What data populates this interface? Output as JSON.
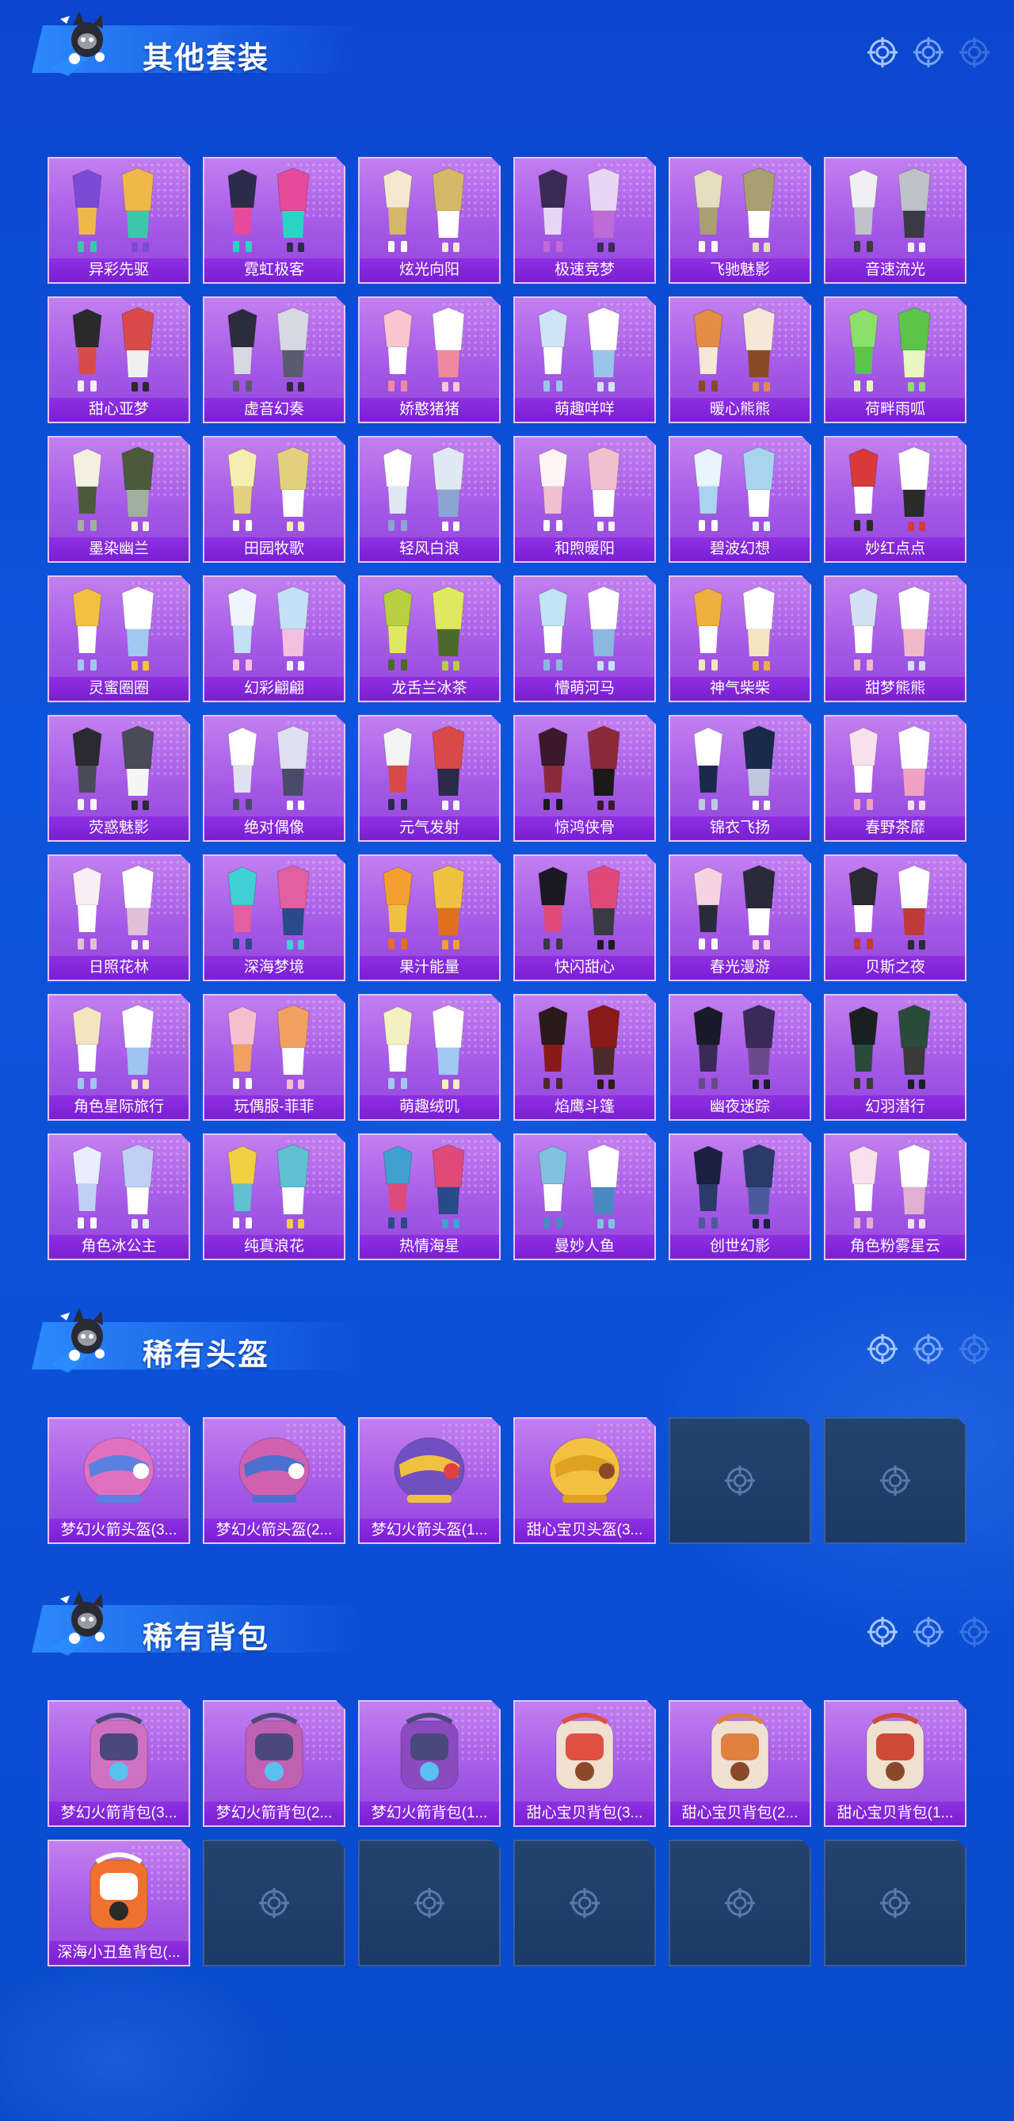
{
  "sections": [
    {
      "title": "其他套装",
      "cells": [
        {
          "label": "异彩先驱",
          "palette": [
            "#7b4bd8",
            "#f0b84a",
            "#3cc7a8"
          ]
        },
        {
          "label": "霓虹极客",
          "palette": [
            "#2c2c4a",
            "#e64a9a",
            "#2ad4c4"
          ]
        },
        {
          "label": "炫光向阳",
          "palette": [
            "#f4e9d0",
            "#d5b76a",
            "#ffffff"
          ]
        },
        {
          "label": "极速竞梦",
          "palette": [
            "#3a2a55",
            "#e8d6f4",
            "#c06ad8"
          ]
        },
        {
          "label": "飞驰魅影",
          "palette": [
            "#e6dcc0",
            "#a8a070",
            "#ffffff"
          ]
        },
        {
          "label": "音速流光",
          "palette": [
            "#f0f0f4",
            "#c0c0c8",
            "#3a3a44"
          ]
        },
        {
          "label": "甜心亚梦",
          "palette": [
            "#2a2a2a",
            "#d94a4a",
            "#f0f0f0"
          ]
        },
        {
          "label": "虚音幻奏",
          "palette": [
            "#2c2c3c",
            "#d8d8e4",
            "#5a5a70"
          ]
        },
        {
          "label": "娇憨猪猪",
          "palette": [
            "#f7c6cf",
            "#ffffff",
            "#f08aa0"
          ]
        },
        {
          "label": "萌趣咩咩",
          "palette": [
            "#cfe5f7",
            "#ffffff",
            "#9ac4ea"
          ]
        },
        {
          "label": "暖心熊熊",
          "palette": [
            "#e28c46",
            "#f5e8d6",
            "#8a4a2a"
          ]
        },
        {
          "label": "荷畔雨呱",
          "palette": [
            "#8be06a",
            "#5cc44a",
            "#e8f7c0"
          ]
        },
        {
          "label": "墨染幽兰",
          "palette": [
            "#f4f0e0",
            "#4a5a3a",
            "#a0b0a0"
          ]
        },
        {
          "label": "田园牧歌",
          "palette": [
            "#f4eeb0",
            "#e0d080",
            "#ffffff"
          ]
        },
        {
          "label": "轻风白浪",
          "palette": [
            "#ffffff",
            "#e0e8f4",
            "#8aa4d4"
          ]
        },
        {
          "label": "和煦暖阳",
          "palette": [
            "#fff4f4",
            "#f0c0d0",
            "#ffffff"
          ]
        },
        {
          "label": "碧波幻想",
          "palette": [
            "#e8f4ff",
            "#a8d4f0",
            "#ffffff"
          ]
        },
        {
          "label": "妙红点点",
          "palette": [
            "#d83a3a",
            "#ffffff",
            "#2a2a2a"
          ]
        },
        {
          "label": "灵蜜圈圈",
          "palette": [
            "#f4c040",
            "#ffffff",
            "#a0c8f0"
          ]
        },
        {
          "label": "幻彩翩翩",
          "palette": [
            "#f0f4ff",
            "#c4e0f4",
            "#f4c0e0"
          ]
        },
        {
          "label": "龙舌兰冰茶",
          "palette": [
            "#b8d040",
            "#e0e860",
            "#4a6a2a"
          ]
        },
        {
          "label": "懵萌河马",
          "palette": [
            "#c0e4f4",
            "#ffffff",
            "#8ab8e0"
          ]
        },
        {
          "label": "神气柴柴",
          "palette": [
            "#f0b040",
            "#ffffff",
            "#f4e4c0"
          ]
        },
        {
          "label": "甜梦熊熊",
          "palette": [
            "#d4e0f4",
            "#ffffff",
            "#f0b8c8"
          ]
        },
        {
          "label": "荧惑魅影",
          "palette": [
            "#2a2a30",
            "#4a4a58",
            "#f4f4f4"
          ]
        },
        {
          "label": "绝对偶像",
          "palette": [
            "#ffffff",
            "#e0e0f0",
            "#4a4a6a"
          ]
        },
        {
          "label": "元气发射",
          "palette": [
            "#f4f4f4",
            "#d84a4a",
            "#2a2a4a"
          ]
        },
        {
          "label": "惊鸿侠骨",
          "palette": [
            "#3a1a2a",
            "#8a2a3a",
            "#1a1a1a"
          ]
        },
        {
          "label": "锦衣飞扬",
          "palette": [
            "#ffffff",
            "#1a2a4a",
            "#c0c8e0"
          ]
        },
        {
          "label": "春野茶靡",
          "palette": [
            "#f8e0ec",
            "#ffffff",
            "#f0a0c0"
          ]
        },
        {
          "label": "日照花林",
          "palette": [
            "#f8eef4",
            "#ffffff",
            "#e0c0d8"
          ]
        },
        {
          "label": "深海梦境",
          "palette": [
            "#40d0d4",
            "#e060a0",
            "#2a4a8a"
          ]
        },
        {
          "label": "果汁能量",
          "palette": [
            "#f4a030",
            "#f0c040",
            "#e07020"
          ]
        },
        {
          "label": "快闪甜心",
          "palette": [
            "#1a1a20",
            "#e04a7a",
            "#3a3a44"
          ]
        },
        {
          "label": "春光漫游",
          "palette": [
            "#f4d4e0",
            "#2a2a3a",
            "#ffffff"
          ]
        },
        {
          "label": "贝斯之夜",
          "palette": [
            "#2a2a30",
            "#ffffff",
            "#c03a3a"
          ]
        },
        {
          "label": "角色星际旅行",
          "palette": [
            "#f4e4c0",
            "#ffffff",
            "#a0c4f0"
          ]
        },
        {
          "label": "玩偶服-菲菲",
          "palette": [
            "#f4c0d0",
            "#f0a060",
            "#ffffff"
          ]
        },
        {
          "label": "萌趣绒叽",
          "palette": [
            "#f4f0c0",
            "#ffffff",
            "#a0c8f0"
          ]
        },
        {
          "label": "焰鹰斗篷",
          "palette": [
            "#2a1a1a",
            "#8a1a1a",
            "#4a2a2a"
          ]
        },
        {
          "label": "幽夜迷踪",
          "palette": [
            "#1a1a2a",
            "#3a2a5a",
            "#6a4a8a"
          ]
        },
        {
          "label": "幻羽潜行",
          "palette": [
            "#1a2020",
            "#2a4a3a",
            "#3a3a3a"
          ]
        },
        {
          "label": "角色冰公主",
          "palette": [
            "#e8eeff",
            "#c0d0f4",
            "#ffffff"
          ]
        },
        {
          "label": "纯真浪花",
          "palette": [
            "#f0d040",
            "#60c0d0",
            "#ffffff"
          ]
        },
        {
          "label": "热情海星",
          "palette": [
            "#40a0d0",
            "#e04a7a",
            "#2a4a8a"
          ]
        },
        {
          "label": "曼妙人鱼",
          "palette": [
            "#80c0e0",
            "#ffffff",
            "#4a8ac0"
          ]
        },
        {
          "label": "创世幻影",
          "palette": [
            "#1a2040",
            "#2a3a6a",
            "#4a5a9a"
          ]
        },
        {
          "label": "角色粉雾星云",
          "palette": [
            "#f8e0ec",
            "#ffffff",
            "#e0b0d0"
          ]
        }
      ]
    },
    {
      "title": "稀有头盔",
      "cells": [
        {
          "label": "梦幻火箭头盔(3...",
          "palette": [
            "#e070c0",
            "#5a80e0",
            "#ffffff"
          ]
        },
        {
          "label": "梦幻火箭头盔(2...",
          "palette": [
            "#d060b0",
            "#4a70d0",
            "#ffffff"
          ]
        },
        {
          "label": "梦幻火箭头盔(1...",
          "palette": [
            "#7050c0",
            "#f0c040",
            "#e04040"
          ]
        },
        {
          "label": "甜心宝贝头盔(3...",
          "palette": [
            "#f4c040",
            "#e0a020",
            "#8a4a2a"
          ]
        },
        {
          "empty": true
        },
        {
          "empty": true
        }
      ]
    },
    {
      "title": "稀有背包",
      "cells": [
        {
          "label": "梦幻火箭背包(3...",
          "palette": [
            "#d070c0",
            "#4a4a7a",
            "#5ac0f0"
          ]
        },
        {
          "label": "梦幻火箭背包(2...",
          "palette": [
            "#c060b0",
            "#4a4a7a",
            "#5ac0f0"
          ]
        },
        {
          "label": "梦幻火箭背包(1...",
          "palette": [
            "#8a4ac0",
            "#4a4a7a",
            "#5ac0f0"
          ]
        },
        {
          "label": "甜心宝贝背包(3...",
          "palette": [
            "#f0e0d0",
            "#e05040",
            "#8a4a2a"
          ]
        },
        {
          "label": "甜心宝贝背包(2...",
          "palette": [
            "#f0e0d0",
            "#e08040",
            "#8a4a2a"
          ]
        },
        {
          "label": "甜心宝贝背包(1...",
          "palette": [
            "#f0e0d0",
            "#d04a3a",
            "#8a4a2a"
          ]
        },
        {
          "label": "深海小丑鱼背包(...",
          "palette": [
            "#f07030",
            "#ffffff",
            "#2a2a2a"
          ]
        },
        {
          "empty": true
        },
        {
          "empty": true
        },
        {
          "empty": true
        },
        {
          "empty": true
        },
        {
          "empty": true
        }
      ]
    }
  ]
}
